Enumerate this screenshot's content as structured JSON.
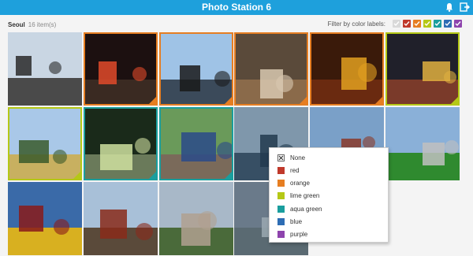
{
  "app": {
    "title": "Photo Station 6"
  },
  "album": {
    "name": "Seoul",
    "count": "16 item(s)"
  },
  "filter": {
    "label": "Filter by color labels:",
    "boxes": [
      {
        "color": "#d9d9d9"
      },
      {
        "color": "#c0392b"
      },
      {
        "color": "#e67e22"
      },
      {
        "color": "#b5c816"
      },
      {
        "color": "#1a9e9e"
      },
      {
        "color": "#2e6db4"
      },
      {
        "color": "#8e44ad"
      }
    ]
  },
  "menu": {
    "items": [
      {
        "label": "None",
        "color": "#ffffff"
      },
      {
        "label": "red",
        "color": "#c0392b"
      },
      {
        "label": "orange",
        "color": "#e67e22"
      },
      {
        "label": "lime green",
        "color": "#b5c816"
      },
      {
        "label": "aqua green",
        "color": "#1a9e9e"
      },
      {
        "label": "blue",
        "color": "#2e6db4"
      },
      {
        "label": "purple",
        "color": "#8e44ad"
      }
    ]
  },
  "photos": [
    {
      "label": "",
      "desc": "palace-pavilion",
      "sky": "#c9d6e3",
      "ground": "#4a4a4a",
      "accent": "#2a2a2a"
    },
    {
      "label": "orange",
      "desc": "night-street-signs",
      "sky": "#1c1010",
      "ground": "#3a2a22",
      "accent": "#e04a2a"
    },
    {
      "label": "orange",
      "desc": "crane-silhouette",
      "sky": "#9fc3e6",
      "ground": "#3b4a5a",
      "accent": "#1a1a1a"
    },
    {
      "label": "orange",
      "desc": "wooden-carvings",
      "sky": "#5a4a3a",
      "ground": "#8a6a4a",
      "accent": "#d8c8b0"
    },
    {
      "label": "orange",
      "desc": "kimchi-stew",
      "sky": "#3a1a0a",
      "ground": "#6a2a10",
      "accent": "#e2a020"
    },
    {
      "label": "lime",
      "desc": "lanterns-crowd",
      "sky": "#20202a",
      "ground": "#7a3a2a",
      "accent": "#e0b040"
    },
    {
      "label": "lime",
      "desc": "river-park-bench",
      "sky": "#a9c8e8",
      "ground": "#c8b060",
      "accent": "#3a5a2a"
    },
    {
      "label": "aqua",
      "desc": "tunnel-rails",
      "sky": "#1a2a1a",
      "ground": "#6a7a5a",
      "accent": "#cfe0a0"
    },
    {
      "label": "aqua",
      "desc": "rail-bike-riders",
      "sky": "#6a9a5a",
      "ground": "#7a6a5a",
      "accent": "#2a4a8a"
    },
    {
      "label": "",
      "desc": "city-street",
      "sky": "#b8c8d8",
      "ground": "#4a5a6a",
      "accent": "#2a3a4a"
    },
    {
      "label": "",
      "desc": "building-trees",
      "sky": "#7aa0c8",
      "ground": "#4a7a3a",
      "accent": "#8a3a2a"
    },
    {
      "label": "",
      "desc": "stadium-field",
      "sky": "#8ab0d8",
      "ground": "#2f8a2f",
      "accent": "#c0c0c0"
    },
    {
      "label": "",
      "desc": "baseball-fans",
      "sky": "#3a6aa8",
      "ground": "#d8b020",
      "accent": "#8a1a1a"
    },
    {
      "label": "",
      "desc": "palace-gate",
      "sky": "#a8c0d8",
      "ground": "#5a4a3a",
      "accent": "#8a2a1a"
    },
    {
      "label": "",
      "desc": "hillside-village",
      "sky": "#a8b8c8",
      "ground": "#4a6a3a",
      "accent": "#b0a090"
    },
    {
      "label": "",
      "desc": "engraved-stone",
      "sky": "#6a7a8a",
      "ground": "#5a6a72",
      "accent": "#9aa8b0"
    }
  ]
}
